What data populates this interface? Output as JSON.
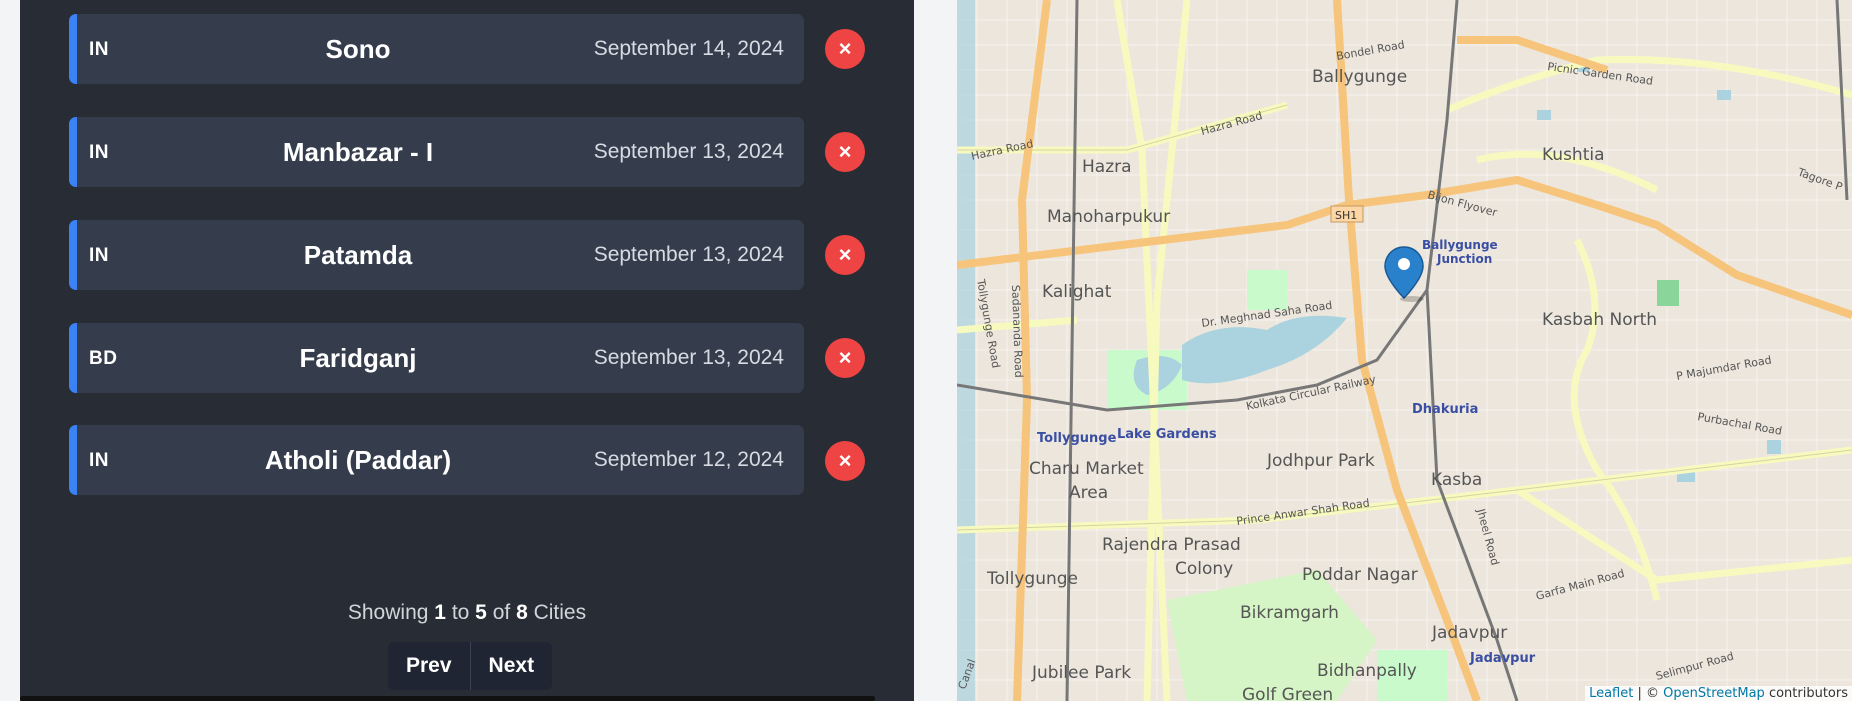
{
  "cities": [
    {
      "country": "IN",
      "name": "Sono",
      "date": "September 14, 2024"
    },
    {
      "country": "IN",
      "name": "Manbazar - I",
      "date": "September 13, 2024"
    },
    {
      "country": "IN",
      "name": "Patamda",
      "date": "September 13, 2024"
    },
    {
      "country": "BD",
      "name": "Faridganj",
      "date": "September 13, 2024"
    },
    {
      "country": "IN",
      "name": "Atholi (Paddar)",
      "date": "September 12, 2024"
    }
  ],
  "delete_label": "×",
  "pagination": {
    "showing_prefix": "Showing",
    "from": "1",
    "to_word": "to",
    "to": "5",
    "of_word": "of",
    "total": "8",
    "unit": "Cities",
    "prev_label": "Prev",
    "next_label": "Next"
  },
  "map": {
    "labels": {
      "ballygunge": "Ballygunge",
      "bondel": "Bondel Road",
      "picnic": "Picnic Garden Road",
      "hazra_road_1": "Hazra Road",
      "hazra_road_2": "Hazra Road",
      "hazra": "Hazra",
      "kushtia": "Kushtia",
      "tagore": "Tagore P",
      "bijon": "Bijon Flyover",
      "manoharpukur": "Manoharpukur",
      "sh1": "SH1",
      "ballygunge_junction_1": "Ballygunge",
      "ballygunge_junction_2": "Junction",
      "kalighat": "Kalighat",
      "meghnad": "Dr. Meghnad Saha Road",
      "kasbah_north": "Kasbah North",
      "tollygunge_road": "Tollygunge Road",
      "sadananda": "Sadananda Road",
      "pmajumdar": "P Majumdar Road",
      "purbachal": "Purbachal Road",
      "circular_rly": "Kolkata Circular Railway",
      "dhakuria": "Dhakuria",
      "tollygunge_stn": "Tollygunge",
      "lake_gardens": "Lake Gardens",
      "jodhpur": "Jodhpur Park",
      "charu_1": "Charu Market",
      "charu_2": "Area",
      "kasba": "Kasba",
      "prince_anwar": "Prince Anwar Shah Road",
      "rajendra_1": "Rajendra Prasad",
      "rajendra_2": "Colony",
      "tollygunge": "Tollygunge",
      "poddar": "Poddar Nagar",
      "garfa": "Garfa Main Road",
      "bikramgarh": "Bikramgarh",
      "jadavpur": "Jadavpur",
      "jadavpur_stn": "Jadavpur",
      "jubilee": "Jubilee Park",
      "bidhanpally": "Bidhanpally",
      "golf_green": "Golf Green",
      "canal": "Canal",
      "selimpur": "Selimpur Road",
      "jheel": "Jheel Road"
    },
    "attribution": {
      "leaflet": "Leaflet",
      "sep": "| ©",
      "osm": "OpenStreetMap",
      "suffix": "contributors"
    },
    "colors": {
      "land": "#ece6dc",
      "water": "#aad3df",
      "park": "#c8facc",
      "major_road": "#f6c47b",
      "secondary_road": "#f7fabf",
      "rail": "#777777",
      "marker": "#2a81cb"
    }
  },
  "colors": {
    "panel_bg": "#282c34",
    "card_bg": "#353d4d",
    "accent": "#3b82f6",
    "delete": "#ef4444"
  }
}
